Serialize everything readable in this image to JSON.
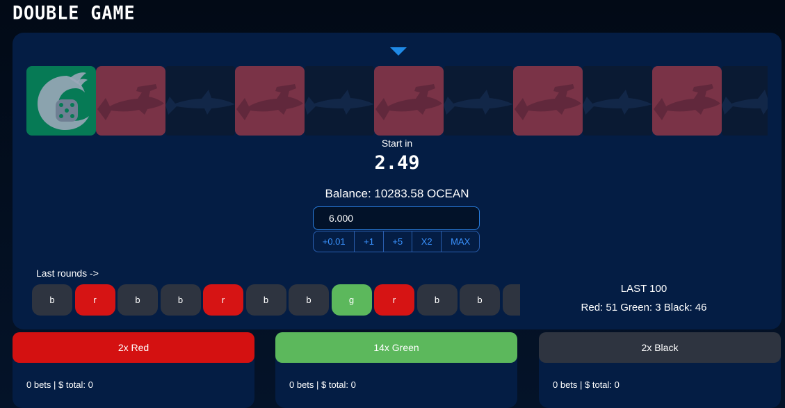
{
  "header": {
    "title": "DOUBLE GAME"
  },
  "strip": {
    "tiles": [
      "green",
      "red",
      "black",
      "red",
      "black",
      "red",
      "black",
      "red",
      "black",
      "red",
      "black"
    ]
  },
  "timer": {
    "label": "Start in",
    "value": "2.49"
  },
  "balance": {
    "text": "Balance: 10283.58 OCEAN"
  },
  "bet": {
    "amount": "6.000",
    "quick": [
      "+0.01",
      "+1",
      "+5",
      "X2",
      "MAX"
    ]
  },
  "last_rounds": {
    "label": "Last rounds ->",
    "items": [
      "b",
      "r",
      "b",
      "b",
      "r",
      "b",
      "b",
      "g",
      "r",
      "b",
      "b",
      "b"
    ]
  },
  "last100": {
    "title": "LAST 100",
    "stats": "Red: 51 Green: 3 Black: 46"
  },
  "options": [
    {
      "label": "2x Red",
      "summary": "0 bets | $ total: 0"
    },
    {
      "label": "14x Green",
      "summary": "0 bets | $ total: 0"
    },
    {
      "label": "2x Black",
      "summary": "0 bets | $ total: 0"
    }
  ],
  "colors": {
    "red": "#d41111",
    "green": "#5cb85c",
    "black": "#2e3440",
    "panel": "#041d44",
    "accent": "#2a7fe0"
  }
}
